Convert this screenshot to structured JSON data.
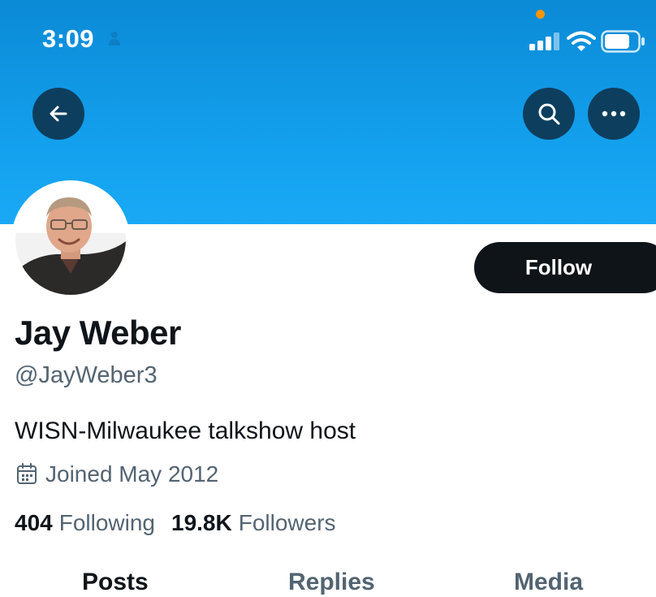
{
  "status_bar": {
    "time": "3:09",
    "icons": [
      "person-icon",
      "signal-icon",
      "wifi-icon",
      "battery-icon"
    ],
    "recording_dot_color": "#ff9500"
  },
  "header": {
    "banner_color": "#1aa9f5",
    "back_icon": "arrow-left-icon",
    "search_icon": "search-icon",
    "more_icon": "more-icon"
  },
  "profile": {
    "display_name": "Jay Weber",
    "handle": "@JayWeber3",
    "bio": "WISN-Milwaukee talkshow host",
    "joined": "Joined May 2012",
    "follow_label": "Follow"
  },
  "stats": {
    "following_count": "404",
    "following_label": "Following",
    "followers_count": "19.8K",
    "followers_label": "Followers"
  },
  "tabs": [
    {
      "label": "Posts",
      "active": true
    },
    {
      "label": "Replies",
      "active": false
    },
    {
      "label": "Media",
      "active": false
    }
  ]
}
